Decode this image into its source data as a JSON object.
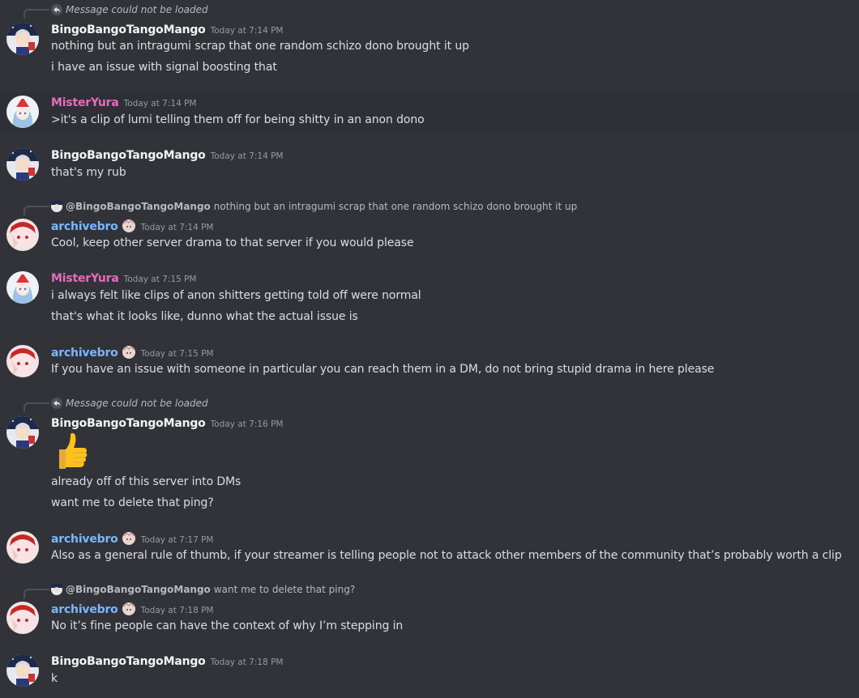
{
  "colors": {
    "background": "#313338",
    "bingo_name": "#f2f3f5",
    "yura_name": "#e86bbd",
    "archive_name": "#7ab7ff",
    "timestamp": "#949ba4",
    "text": "#dbdee1"
  },
  "messages": [
    {
      "reply": {
        "type": "unloaded",
        "icon": "reply-arrow-icon",
        "text": "Message could not be loaded"
      },
      "user": "BingoBangoTangoMango",
      "time": "Today at 7:14 PM",
      "lines": [
        "nothing but an intragumi scrap that one random schizo dono brought it up",
        "i have an issue with signal boosting that"
      ]
    },
    {
      "user": "MisterYura",
      "time": "Today at 7:14 PM",
      "lines": [
        ">it's a clip of lumi telling them off for being shitty in an anon dono"
      ]
    },
    {
      "user": "BingoBangoTangoMango",
      "time": "Today at 7:14 PM",
      "lines": [
        "that's my rub"
      ]
    },
    {
      "reply": {
        "type": "quote",
        "name": "@BingoBangoTangoMango",
        "text": "nothing but an intragumi scrap that one random schizo dono brought it up"
      },
      "user": "archivebro",
      "time": "Today at 7:14 PM",
      "lines": [
        "Cool, keep other server drama to that server if you would please"
      ]
    },
    {
      "user": "MisterYura",
      "time": "Today at 7:15 PM",
      "lines": [
        "i always felt like clips of anon shitters getting told off were normal",
        "that's what it looks like, dunno what the actual issue is"
      ]
    },
    {
      "user": "archivebro",
      "time": "Today at 7:15 PM",
      "lines": [
        "If you have an issue with someone in particular you can reach them in a DM, do not bring stupid drama in here please"
      ]
    },
    {
      "reply": {
        "type": "unloaded",
        "icon": "reply-arrow-icon",
        "text": "Message could not be loaded"
      },
      "user": "BingoBangoTangoMango",
      "time": "Today at 7:16 PM",
      "emoji": "thumbs-up-emoji",
      "lines": [
        "already off of this server into DMs",
        "want me to delete that ping?"
      ]
    },
    {
      "user": "archivebro",
      "time": "Today at 7:17 PM",
      "lines": [
        "Also as a general rule of thumb, if your streamer is telling people not to attack other members of the community that’s probably worth a clip"
      ]
    },
    {
      "reply": {
        "type": "quote",
        "name": "@BingoBangoTangoMango",
        "text": "want me to delete that ping?"
      },
      "user": "archivebro",
      "time": "Today at 7:18 PM",
      "lines": [
        "No it’s fine people can have the context of why I’m stepping in"
      ]
    },
    {
      "user": "BingoBangoTangoMango",
      "time": "Today at 7:18 PM",
      "lines": [
        "k"
      ]
    }
  ]
}
